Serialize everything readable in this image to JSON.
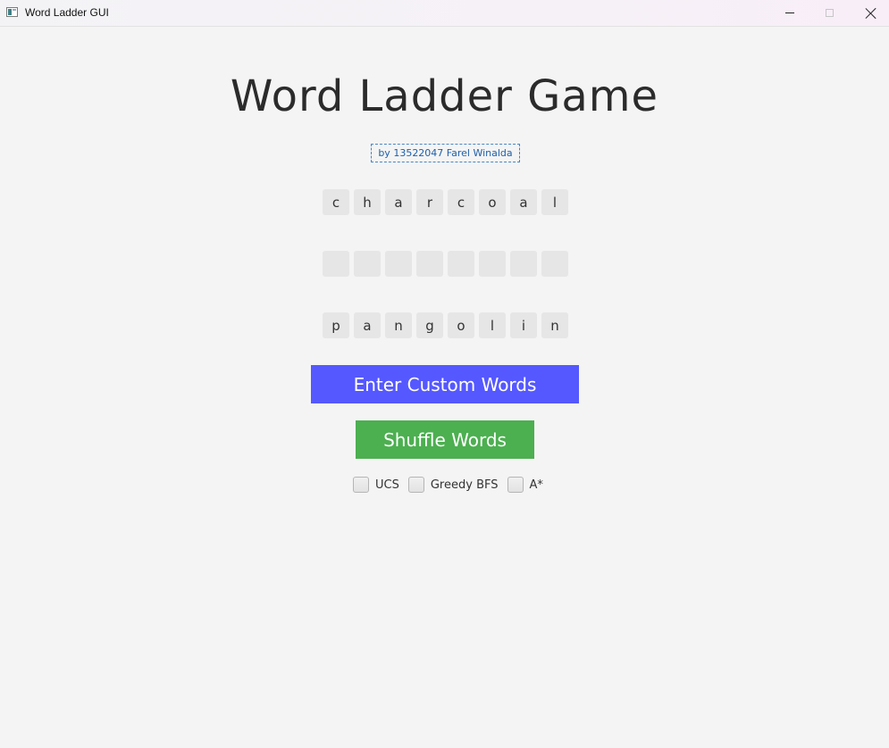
{
  "window": {
    "title": "Word Ladder GUI"
  },
  "header": {
    "title": "Word Ladder Game",
    "author": "by 13522047 Farel Winalda"
  },
  "words": {
    "start": [
      "c",
      "h",
      "a",
      "r",
      "c",
      "o",
      "a",
      "l"
    ],
    "middle": [
      "",
      "",
      "",
      "",
      "",
      "",
      "",
      ""
    ],
    "end": [
      "p",
      "a",
      "n",
      "g",
      "o",
      "l",
      "i",
      "n"
    ]
  },
  "buttons": {
    "custom_label": "Enter Custom Words",
    "shuffle_label": "Shuffle Words"
  },
  "algorithms": [
    {
      "label": "UCS",
      "checked": false
    },
    {
      "label": "Greedy BFS",
      "checked": false
    },
    {
      "label": "A*",
      "checked": false
    }
  ],
  "colors": {
    "custom_button": "#5558ff",
    "shuffle_button": "#4caf50",
    "background": "#f4f4f4",
    "tile": "#e6e6e6",
    "link": "#1f5fa8"
  },
  "icons": {
    "app": "app-window-icon",
    "minimize": "minimize-icon",
    "maximize": "maximize-icon",
    "close": "close-icon"
  }
}
